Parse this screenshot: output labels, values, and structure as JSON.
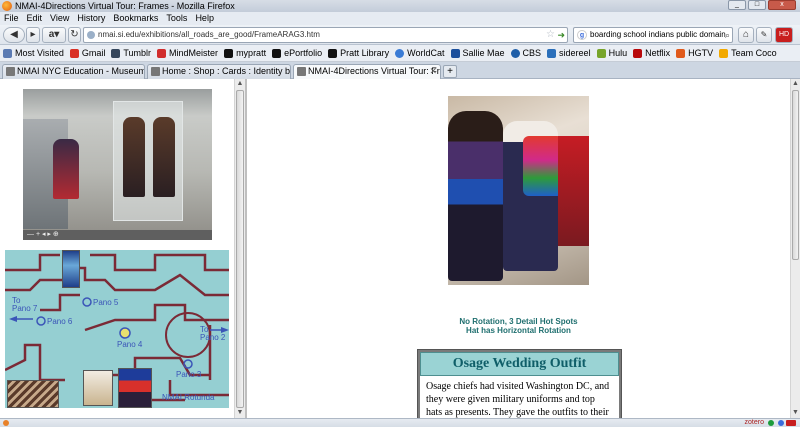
{
  "window": {
    "title": "NMAI-4Directions Virtual Tour: Frames - Mozilla Firefox"
  },
  "menu": [
    "File",
    "Edit",
    "View",
    "History",
    "Bookmarks",
    "Tools",
    "Help"
  ],
  "nav": {
    "url": "nmai.si.edu/exhibitions/all_roads_are_good/FrameARAG3.htm",
    "search_value": "boarding school indians public domain",
    "search_engine": "Google"
  },
  "bookmarks": [
    {
      "label": "Most Visited",
      "color": "#5b7bb3"
    },
    {
      "label": "Gmail",
      "color": "#d93025"
    },
    {
      "label": "Tumblr",
      "color": "#35465c"
    },
    {
      "label": "MindMeister",
      "color": "#d12d2d"
    },
    {
      "label": "mypratt",
      "color": "#111111"
    },
    {
      "label": "ePortfolio",
      "color": "#111111"
    },
    {
      "label": "Pratt Library",
      "color": "#111111"
    },
    {
      "label": "WorldCat",
      "color": "#3a7bd5"
    },
    {
      "label": "Sallie Mae",
      "color": "#1b4f9c"
    },
    {
      "label": "CBS",
      "color": "#1f5ea8"
    },
    {
      "label": "sidereel",
      "color": "#2a6fba"
    },
    {
      "label": "Hulu",
      "color": "#78a52b"
    },
    {
      "label": "Netflix",
      "color": "#b9090b"
    },
    {
      "label": "HGTV",
      "color": "#e05a1c"
    },
    {
      "label": "Team Coco",
      "color": "#f2a900"
    }
  ],
  "tabs": [
    {
      "label": "NMAI NYC Education - Museums"
    },
    {
      "label": "Home : Shop : Cards : Identity by Desi..."
    },
    {
      "label": "NMAI-4Directions Virtual Tour: Frames"
    }
  ],
  "map": {
    "labels": {
      "to_pano7": "To\nPano 7",
      "pano5": "Pano 5",
      "pano6": "Pano 6",
      "pano4": "Pano 4",
      "to_pano2": "To\nPano 2",
      "pano3": "Pano 3",
      "rotunda": "NMAI Rotunda"
    }
  },
  "content": {
    "caption_line1": "No Rotation, 3 Detail Hot Spots",
    "caption_line2": "Hat has Horizontal Rotation",
    "card_title": "Osage Wedding Outfit",
    "card_body": "Osage chiefs had visited Washington DC, and they were given military uniforms and top hats as presents. They gave the outfits to their wives"
  },
  "statusbar": {
    "zotero": "zotero"
  }
}
